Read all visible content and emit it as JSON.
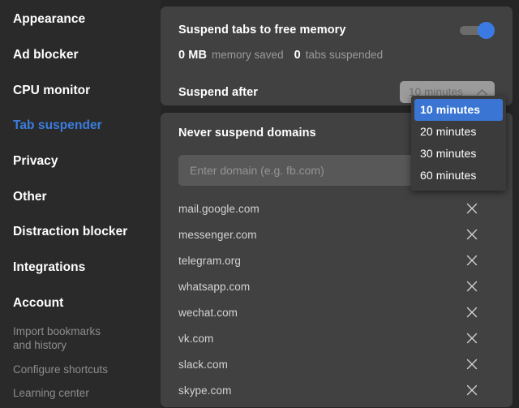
{
  "sidebar": {
    "items": [
      {
        "label": "Appearance",
        "active": false
      },
      {
        "label": "Ad blocker",
        "active": false
      },
      {
        "label": "CPU monitor",
        "active": false
      },
      {
        "label": "Tab suspender",
        "active": true
      },
      {
        "label": "Privacy",
        "active": false
      },
      {
        "label": "Other",
        "active": false
      },
      {
        "label": "Distraction blocker",
        "active": false
      },
      {
        "label": "Integrations",
        "active": false
      },
      {
        "label": "Account",
        "active": false
      }
    ],
    "links": [
      "Import bookmarks",
      "and history",
      "Configure shortcuts",
      "Learning center"
    ],
    "active_color": "#3a7dde"
  },
  "suspend_panel": {
    "title": "Suspend tabs to free memory",
    "toggle_on": true,
    "toggle_accent": "#3b7ae4",
    "memory_value": "0 MB",
    "memory_label": "memory saved",
    "tabs_value": "0",
    "tabs_label": "tabs suspended",
    "suspend_after_label": "Suspend after",
    "selected_option": "10 minutes"
  },
  "dropdown": {
    "open": true,
    "highlight_color": "#3a75d3",
    "options": [
      "10 minutes",
      "20 minutes",
      "30 minutes",
      "60 minutes"
    ],
    "selected_index": 0
  },
  "domains_panel": {
    "title": "Never suspend domains",
    "input_value": "",
    "input_placeholder": "Enter domain (e.g. fb.com)",
    "add_button_label": "+",
    "domains": [
      "mail.google.com",
      "messenger.com",
      "telegram.org",
      "whatsapp.com",
      "wechat.com",
      "vk.com",
      "slack.com",
      "skype.com"
    ]
  }
}
